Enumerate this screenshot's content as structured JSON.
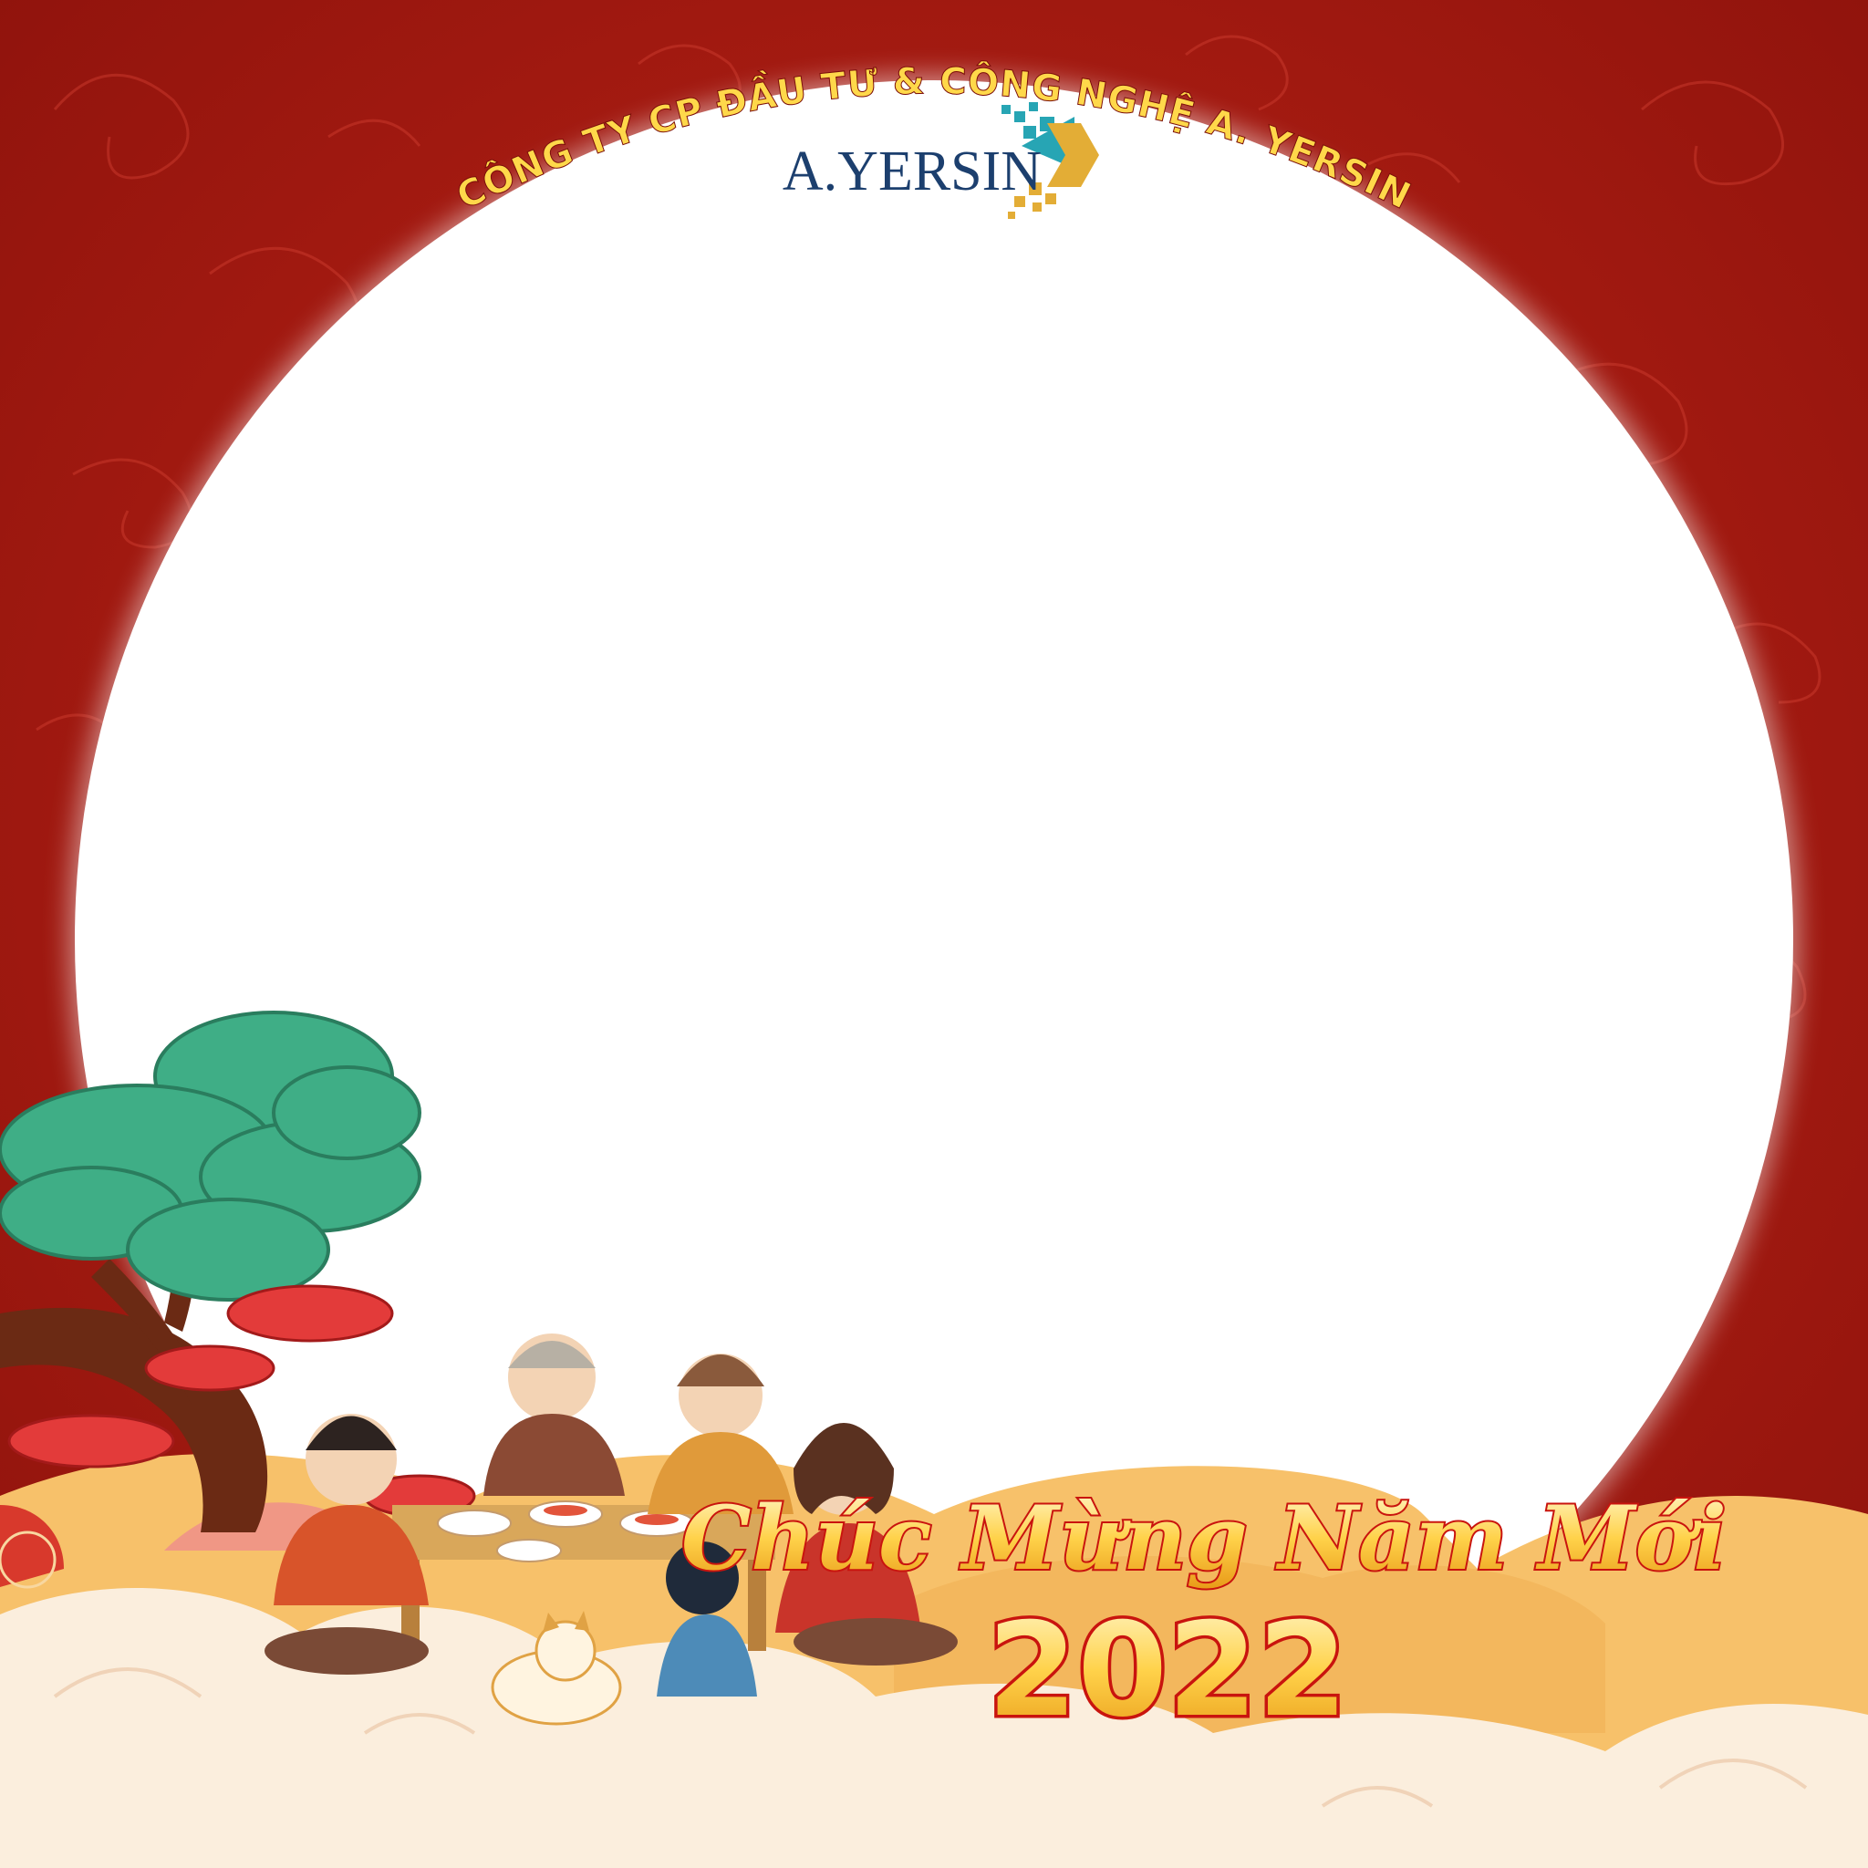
{
  "frame": {
    "company_arc_text": "CÔNG TY CP ĐẦU TƯ & CÔNG NGHỆ A. YERSIN",
    "logo_text": "A.YERSIN",
    "greeting": "Chúc Mừng Năm Mới",
    "year": "2022"
  },
  "colors": {
    "background_red": "#a8170f",
    "arc_text_yellow": "#ffd84a",
    "logo_blue": "#1c3f6e",
    "logo_teal": "#27a5b4",
    "logo_gold": "#e3ad36",
    "cloud_cream": "#fbeedd",
    "cloud_orange": "#f3b75d",
    "tree_green": "#3fae86"
  },
  "icons": [
    "company-logo-mark",
    "pine-tree-illustration",
    "family-dinner-illustration",
    "cloud-decoration"
  ]
}
